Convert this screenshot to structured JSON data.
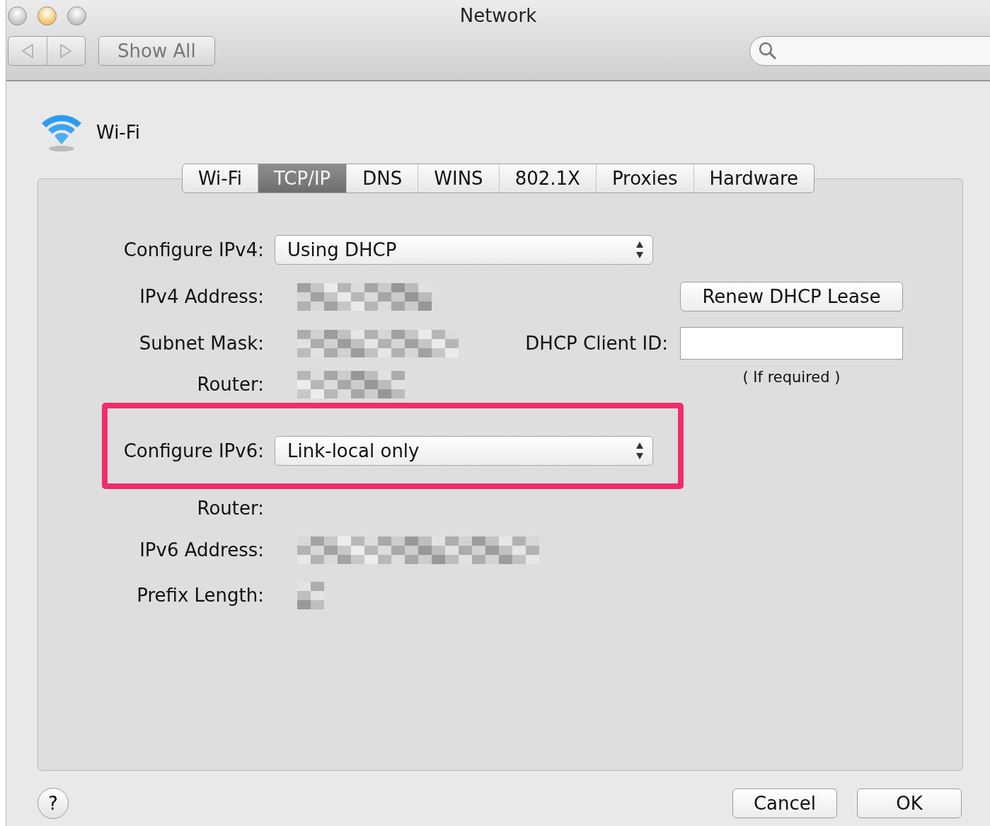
{
  "window": {
    "title": "Network"
  },
  "toolbar": {
    "show_all": "Show All"
  },
  "service": {
    "name": "Wi-Fi"
  },
  "tabs": [
    {
      "label": "Wi-Fi",
      "selected": false
    },
    {
      "label": "TCP/IP",
      "selected": true
    },
    {
      "label": "DNS",
      "selected": false
    },
    {
      "label": "WINS",
      "selected": false
    },
    {
      "label": "802.1X",
      "selected": false
    },
    {
      "label": "Proxies",
      "selected": false
    },
    {
      "label": "Hardware",
      "selected": false
    }
  ],
  "form": {
    "rows": [
      {
        "kind": "select",
        "label": "Configure IPv4:",
        "value": "Using DHCP",
        "highlighted": false
      },
      {
        "kind": "redacted",
        "label": "IPv4 Address:"
      },
      {
        "kind": "redacted",
        "label": "Subnet Mask:"
      },
      {
        "kind": "redacted",
        "label": "Router:"
      },
      {
        "kind": "select",
        "label": "Configure IPv6:",
        "value": "Link-local only",
        "highlighted": true
      },
      {
        "kind": "blank",
        "label": "Router:"
      },
      {
        "kind": "redacted",
        "label": "IPv6 Address:"
      },
      {
        "kind": "redacted",
        "label": "Prefix Length:"
      }
    ],
    "renew_button": "Renew DHCP Lease",
    "client_id": {
      "label": "DHCP Client ID:",
      "hint": "( If required )"
    }
  },
  "footer": {
    "help": "?",
    "buttons": [
      "Cancel",
      "OK"
    ]
  }
}
